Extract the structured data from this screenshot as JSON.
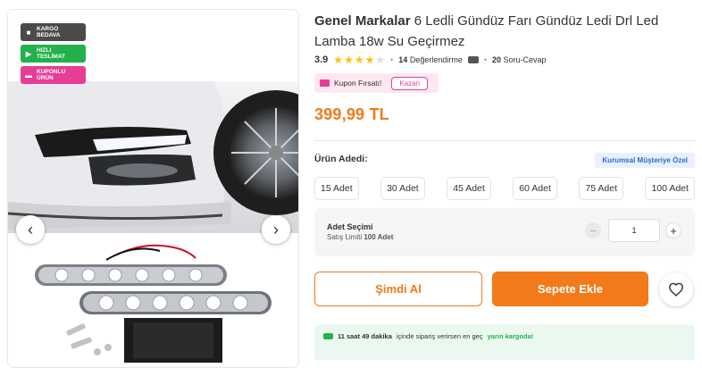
{
  "badges": [
    {
      "line1": "KARGO",
      "line2": "BEDAVA",
      "icon": "box-icon"
    },
    {
      "line1": "HIZLI",
      "line2": "TESLİMAT",
      "icon": "truck-icon"
    },
    {
      "line1": "KUPONLU",
      "line2": "ÜRÜN",
      "icon": "ticket-icon"
    }
  ],
  "gallery": {
    "prev": "‹",
    "next": "›"
  },
  "product": {
    "brand": "Genel Markalar",
    "name": "6 Ledli Gündüz Farı Gündüz Ledi Drl Led Lamba 18w Su Geçirmez",
    "rating": "3.9",
    "rating_value": 3.9,
    "review_count": "14",
    "review_label": "Değerlendirme",
    "qa_count": "20",
    "qa_label": "Soru-Cevap",
    "price": "399,99 TL"
  },
  "coupon": {
    "label": "Kupon Fırsatı!",
    "button": "Kazan"
  },
  "quantity": {
    "label": "Ürün Adedi:",
    "corporate": "Kurumsal Müşteriye Özel",
    "options": [
      "15 Adet",
      "30 Adet",
      "45 Adet",
      "60 Adet",
      "75 Adet",
      "100 Adet"
    ],
    "selection_title": "Adet Seçimi",
    "limit_prefix": "Satış Limiti",
    "limit_value": "100 Adet",
    "minus": "−",
    "value": "1",
    "plus": "+"
  },
  "actions": {
    "buy_now": "Şimdi Al",
    "add_to_cart": "Sepete Ekle"
  },
  "shipping": {
    "time": "11 saat 49 dakika",
    "middle": "içinde sipariş verirsen en geç",
    "highlight": "yarın kargoda!"
  },
  "colors": {
    "accent": "#f27a1a",
    "coupon": "#e63d96",
    "green": "#21b24b",
    "star": "#ffc000"
  }
}
